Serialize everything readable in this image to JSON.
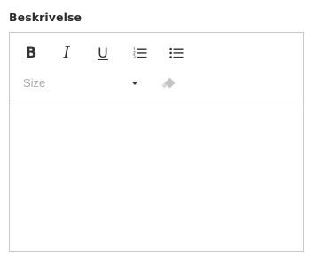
{
  "field": {
    "label": "Beskrivelse"
  },
  "toolbar": {
    "bold_label": "B",
    "italic_label": "I",
    "underline_label": "U",
    "ordered_list_icon": "ordered-list-icon",
    "unordered_list_icon": "unordered-list-icon",
    "size_select": {
      "value": "Size",
      "icon": "caret-down-icon"
    },
    "clear_format_icon": "eraser-icon"
  },
  "content": {
    "text": ""
  },
  "colors": {
    "label_text": "#2b2b2b",
    "icon": "#333333",
    "placeholder": "#a8a8a8",
    "eraser_disabled": "#c4c4c4",
    "border": "#c9c9c9"
  }
}
